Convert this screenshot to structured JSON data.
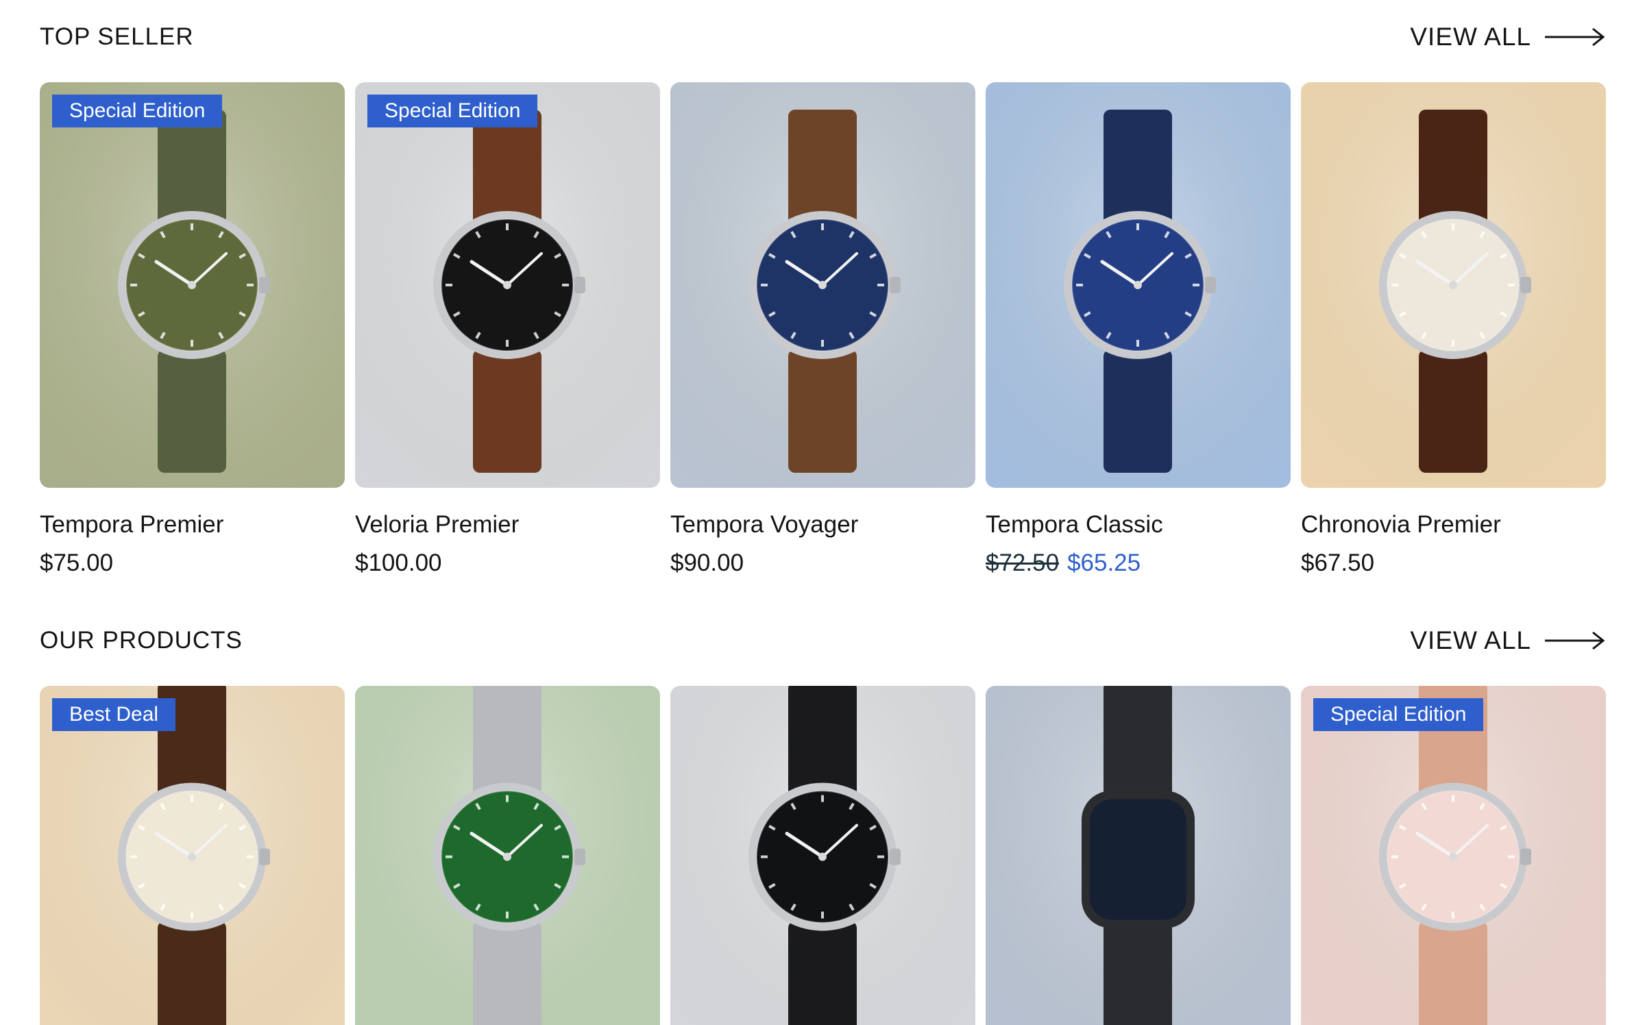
{
  "top_seller": {
    "title": "TOP SELLER",
    "view_all": "VIEW ALL",
    "products": [
      {
        "name": "Tempora Premier",
        "price": "$75.00",
        "badge": "Special Edition",
        "bg": "#a9ae8a",
        "strap": "#566040",
        "dial": "#5f6a3c"
      },
      {
        "name": "Veloria Premier",
        "price": "$100.00",
        "badge": "Special Edition",
        "bg": "#d4d5da",
        "strap": "#6b3a20",
        "dial": "#151515"
      },
      {
        "name": "Tempora Voyager",
        "price": "$90.00",
        "badge": "",
        "bg": "#b9c3d2",
        "strap": "#6e4428",
        "dial": "#1f3466"
      },
      {
        "name": "Tempora Classic",
        "old_price": "$72.50",
        "sale_price": "$65.25",
        "badge": "",
        "bg": "#a3bde0",
        "strap": "#1f2f5c",
        "dial": "#243e86"
      },
      {
        "name": "Chronovia Premier",
        "price": "$67.50",
        "badge": "",
        "bg": "#ecd3ad",
        "strap": "#4a2516",
        "dial": "#eee8dc"
      }
    ]
  },
  "our_products": {
    "title": "OUR PRODUCTS",
    "view_all": "VIEW ALL",
    "products": [
      {
        "badge": "Best Deal",
        "bg": "#ecd6b5",
        "strap": "#4a2a18",
        "dial": "#f0e8d6"
      },
      {
        "badge": "",
        "bg": "#b8cdb0",
        "strap": "#b7b9bd",
        "dial": "#1e6a2c"
      },
      {
        "badge": "",
        "bg": "#d4d6dc",
        "strap": "#1a1a1c",
        "dial": "#111214"
      },
      {
        "badge": "",
        "bg": "#b6c0d2",
        "strap": "#2a2b2e",
        "dial": "#162033"
      },
      {
        "badge": "Special Edition",
        "bg": "#ead0cc",
        "strap": "#d9a58c",
        "dial": "#f3d9d3"
      }
    ]
  }
}
